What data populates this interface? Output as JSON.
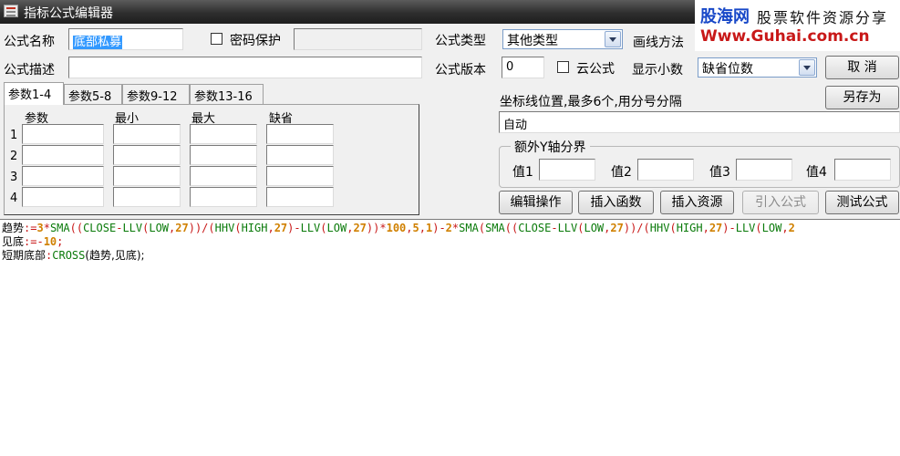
{
  "window": {
    "title": "指标公式编辑器"
  },
  "watermark": {
    "brand": "股海网",
    "slogan": "股票软件资源分享",
    "url": "Www.Guhai.com.cn"
  },
  "form": {
    "name_label": "公式名称",
    "name_value": "底部私募",
    "password_label": "密码保护",
    "desc_label": "公式描述",
    "desc_value": "",
    "type_label": "公式类型",
    "type_value": "其他类型",
    "draw_label": "画线方法",
    "version_label": "公式版本",
    "version_value": "0",
    "cloud_label": "云公式",
    "decimal_label": "显示小数",
    "decimal_value": "缺省位数"
  },
  "buttons": {
    "cancel": "取 消",
    "save_as": "另存为",
    "edit_ops": "编辑操作",
    "insert_func": "插入函数",
    "insert_res": "插入资源",
    "import_formula": "引入公式",
    "test_formula": "测试公式"
  },
  "tabs": [
    "参数1-4",
    "参数5-8",
    "参数9-12",
    "参数13-16"
  ],
  "params": {
    "headers": [
      "参数",
      "最小",
      "最大",
      "缺省"
    ],
    "rows": [
      "1",
      "2",
      "3",
      "4"
    ]
  },
  "coord": {
    "label": "坐标线位置,最多6个,用分号分隔",
    "value": "自动"
  },
  "yaxis": {
    "title": "额外Y轴分界",
    "labels": [
      "值1",
      "值2",
      "值3",
      "值4"
    ]
  },
  "code": {
    "line1": [
      {
        "t": "趋势",
        "c": "txt"
      },
      {
        "t": ":=",
        "c": "op"
      },
      {
        "t": "3",
        "c": "num"
      },
      {
        "t": "*",
        "c": "op"
      },
      {
        "t": "SMA",
        "c": "fn"
      },
      {
        "t": "((",
        "c": "op"
      },
      {
        "t": "CLOSE",
        "c": "fn"
      },
      {
        "t": "-",
        "c": "op"
      },
      {
        "t": "LLV",
        "c": "fn"
      },
      {
        "t": "(",
        "c": "op"
      },
      {
        "t": "LOW",
        "c": "fn"
      },
      {
        "t": ",",
        "c": "op"
      },
      {
        "t": "27",
        "c": "num"
      },
      {
        "t": "))/(",
        "c": "op"
      },
      {
        "t": "HHV",
        "c": "fn"
      },
      {
        "t": "(",
        "c": "op"
      },
      {
        "t": "HIGH",
        "c": "fn"
      },
      {
        "t": ",",
        "c": "op"
      },
      {
        "t": "27",
        "c": "num"
      },
      {
        "t": ")-",
        "c": "op"
      },
      {
        "t": "LLV",
        "c": "fn"
      },
      {
        "t": "(",
        "c": "op"
      },
      {
        "t": "LOW",
        "c": "fn"
      },
      {
        "t": ",",
        "c": "op"
      },
      {
        "t": "27",
        "c": "num"
      },
      {
        "t": "))*",
        "c": "op"
      },
      {
        "t": "100",
        "c": "num"
      },
      {
        "t": ",",
        "c": "op"
      },
      {
        "t": "5",
        "c": "num"
      },
      {
        "t": ",",
        "c": "op"
      },
      {
        "t": "1",
        "c": "num"
      },
      {
        "t": ")-",
        "c": "op"
      },
      {
        "t": "2",
        "c": "num"
      },
      {
        "t": "*",
        "c": "op"
      },
      {
        "t": "SMA",
        "c": "fn"
      },
      {
        "t": "(",
        "c": "op"
      },
      {
        "t": "SMA",
        "c": "fn"
      },
      {
        "t": "((",
        "c": "op"
      },
      {
        "t": "CLOSE",
        "c": "fn"
      },
      {
        "t": "-",
        "c": "op"
      },
      {
        "t": "LLV",
        "c": "fn"
      },
      {
        "t": "(",
        "c": "op"
      },
      {
        "t": "LOW",
        "c": "fn"
      },
      {
        "t": ",",
        "c": "op"
      },
      {
        "t": "27",
        "c": "num"
      },
      {
        "t": "))/(",
        "c": "op"
      },
      {
        "t": "HHV",
        "c": "fn"
      },
      {
        "t": "(",
        "c": "op"
      },
      {
        "t": "HIGH",
        "c": "fn"
      },
      {
        "t": ",",
        "c": "op"
      },
      {
        "t": "27",
        "c": "num"
      },
      {
        "t": ")-",
        "c": "op"
      },
      {
        "t": "LLV",
        "c": "fn"
      },
      {
        "t": "(",
        "c": "op"
      },
      {
        "t": "LOW",
        "c": "fn"
      },
      {
        "t": ",",
        "c": "op"
      },
      {
        "t": "2",
        "c": "num"
      }
    ],
    "line2": [
      {
        "t": "见底",
        "c": "txt"
      },
      {
        "t": ":=",
        "c": "op"
      },
      {
        "t": "-",
        "c": "op"
      },
      {
        "t": "10",
        "c": "num"
      },
      {
        "t": ";",
        "c": "op"
      }
    ],
    "line3": [
      {
        "t": "短期底部",
        "c": "txt"
      },
      {
        "t": ":",
        "c": "op"
      },
      {
        "t": "CROSS",
        "c": "fn"
      },
      {
        "t": "(趋势,见底);",
        "c": "txt"
      }
    ]
  }
}
